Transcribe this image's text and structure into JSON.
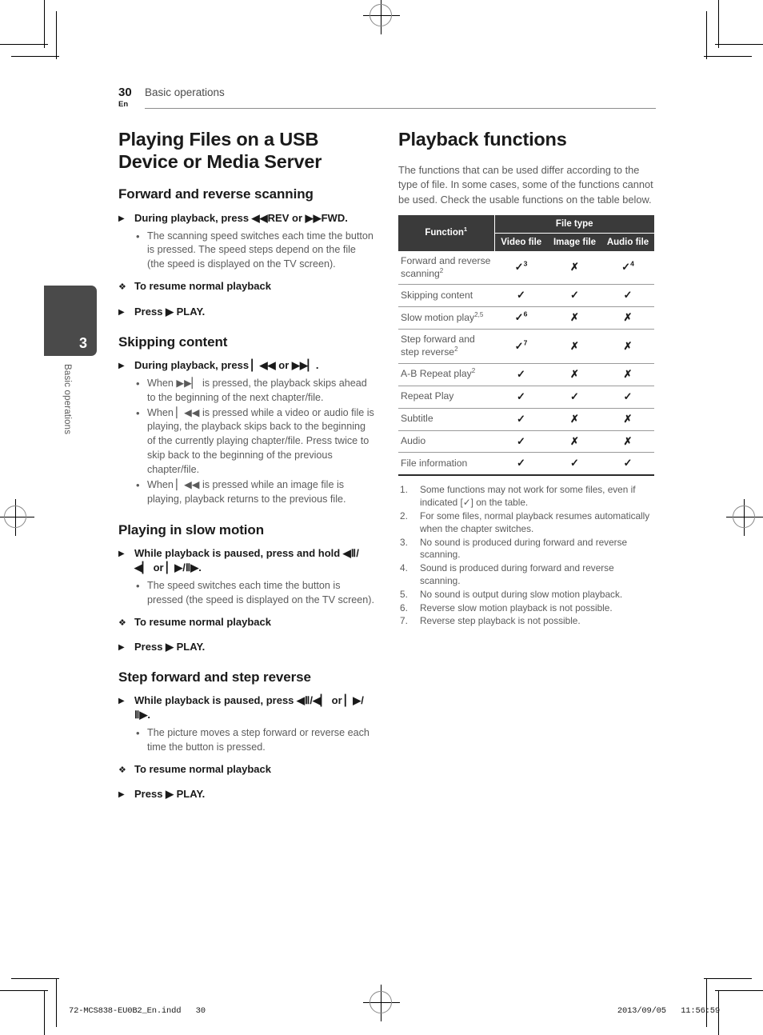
{
  "header": {
    "page_number": "30",
    "language": "En",
    "running_title": "Basic operations"
  },
  "tab": {
    "chapter_number": "3",
    "chapter_label": "Basic operations"
  },
  "left_column": {
    "title": "Playing Files on a USB Device or Media Server",
    "sections": [
      {
        "heading": "Forward and reverse scanning",
        "steps": [
          {
            "marker": "▶",
            "text": "During playback, press ◀◀REV or ▶▶FWD.",
            "bullets": [
              "The scanning speed switches each time the button is pressed. The speed steps depend on the file (the speed is displayed on the TV screen)."
            ]
          },
          {
            "marker": "❖",
            "text": "To resume normal playback",
            "bullets": []
          },
          {
            "marker": "▶",
            "text": "Press ▶ PLAY.",
            "bullets": []
          }
        ]
      },
      {
        "heading": "Skipping content",
        "steps": [
          {
            "marker": "▶",
            "text": "During playback, press ▏◀◀ or ▶▶▏.",
            "bullets": [
              "When ▶▶▏ is pressed, the playback skips ahead to the beginning of the next chapter/file.",
              "When ▏◀◀ is pressed while a video or audio file is playing, the playback skips back to the beginning of the currently playing chapter/file. Press twice to skip back to the beginning of the previous chapter/file.",
              "When ▏◀◀ is pressed while an image file is playing, playback returns to the previous file."
            ]
          }
        ]
      },
      {
        "heading": "Playing in slow motion",
        "steps": [
          {
            "marker": "▶",
            "text": "While playback is paused, press and hold ◀Ⅱ/◀▏ or ▏▶/Ⅱ▶.",
            "bullets": [
              "The speed switches each time the button is pressed (the speed is displayed on the TV screen)."
            ]
          },
          {
            "marker": "❖",
            "text": "To resume normal playback",
            "bullets": []
          },
          {
            "marker": "▶",
            "text": "Press ▶ PLAY.",
            "bullets": []
          }
        ]
      },
      {
        "heading": "Step forward and step reverse",
        "steps": [
          {
            "marker": "▶",
            "text": "While playback is paused, press ◀Ⅱ/◀▏ or ▏▶/Ⅱ▶.",
            "bullets": [
              "The picture moves a step forward or reverse each time the button is pressed."
            ]
          },
          {
            "marker": "❖",
            "text": "To resume normal playback",
            "bullets": []
          },
          {
            "marker": "▶",
            "text": "Press ▶ PLAY.",
            "bullets": []
          }
        ]
      }
    ]
  },
  "right_column": {
    "title": "Playback functions",
    "intro": "The functions that can be used differ according to the type of file. In some cases, some of the functions cannot be used. Check the usable functions on the table below.",
    "table": {
      "col_function": "Function",
      "col_function_sup": "1",
      "col_group": "File type",
      "subheaders": [
        "Video file",
        "Image file",
        "Audio file"
      ],
      "check_glyph": "✓",
      "cross_glyph": "✗",
      "rows": [
        {
          "name": "Forward and reverse scanning",
          "name_sup": "2",
          "video": "✓",
          "video_sup": "3",
          "image": "✗",
          "image_sup": "",
          "audio": "✓",
          "audio_sup": "4"
        },
        {
          "name": "Skipping content",
          "name_sup": "",
          "video": "✓",
          "video_sup": "",
          "image": "✓",
          "image_sup": "",
          "audio": "✓",
          "audio_sup": ""
        },
        {
          "name": "Slow motion play",
          "name_sup": "2,5",
          "video": "✓",
          "video_sup": "6",
          "image": "✗",
          "image_sup": "",
          "audio": "✗",
          "audio_sup": ""
        },
        {
          "name": "Step forward and step reverse",
          "name_sup": "2",
          "video": "✓",
          "video_sup": "7",
          "image": "✗",
          "image_sup": "",
          "audio": "✗",
          "audio_sup": ""
        },
        {
          "name": "A-B Repeat play",
          "name_sup": "2",
          "video": "✓",
          "video_sup": "",
          "image": "✗",
          "image_sup": "",
          "audio": "✗",
          "audio_sup": ""
        },
        {
          "name": "Repeat Play",
          "name_sup": "",
          "video": "✓",
          "video_sup": "",
          "image": "✓",
          "image_sup": "",
          "audio": "✓",
          "audio_sup": ""
        },
        {
          "name": "Subtitle",
          "name_sup": "",
          "video": "✓",
          "video_sup": "",
          "image": "✗",
          "image_sup": "",
          "audio": "✗",
          "audio_sup": ""
        },
        {
          "name": "Audio",
          "name_sup": "",
          "video": "✓",
          "video_sup": "",
          "image": "✗",
          "image_sup": "",
          "audio": "✗",
          "audio_sup": ""
        },
        {
          "name": "File information",
          "name_sup": "",
          "video": "✓",
          "video_sup": "",
          "image": "✓",
          "image_sup": "",
          "audio": "✓",
          "audio_sup": ""
        }
      ]
    },
    "footnotes": [
      "Some functions may not work for some files, even if indicated [✓] on the table.",
      "For some files, normal playback resumes automatically when the chapter switches.",
      "No sound is produced during forward and reverse scanning.",
      "Sound is produced during forward and reverse scanning.",
      "No sound is output during slow motion playback.",
      "Reverse slow motion playback is not possible.",
      "Reverse step playback is not possible."
    ]
  },
  "footer": {
    "file_name": "72-MCS838-EU0B2_En.indd   30",
    "timestamp": "2013/09/05   11:56:59"
  }
}
